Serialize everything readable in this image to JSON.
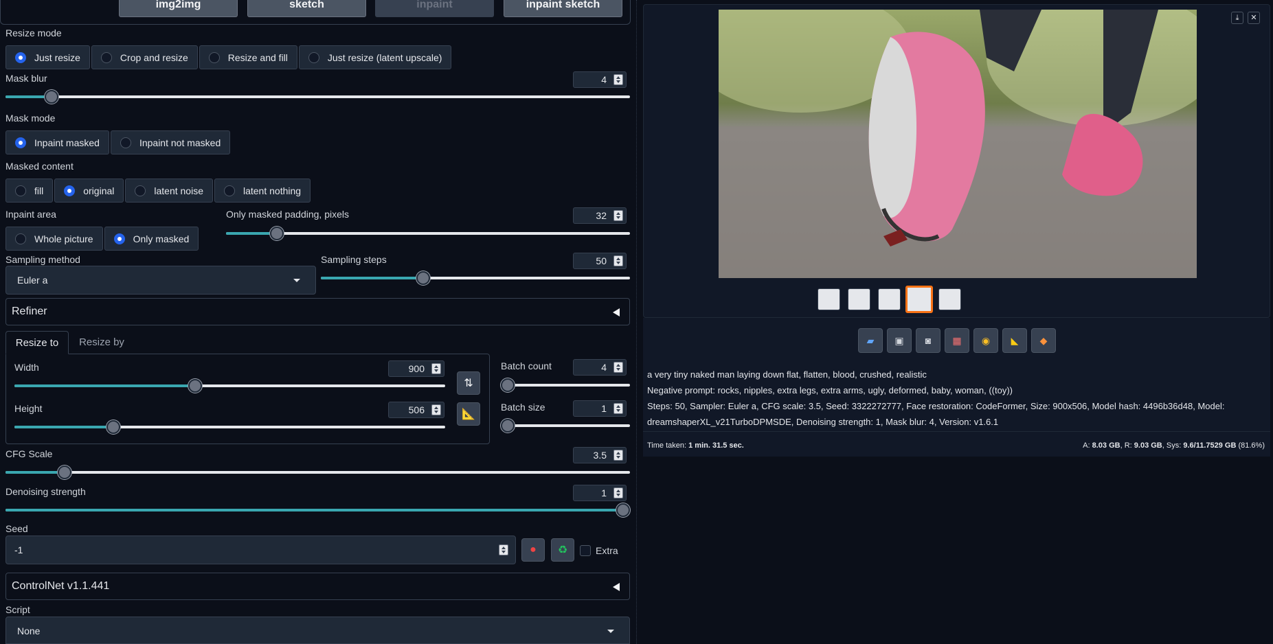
{
  "top_tabs": [
    {
      "label": "img2img",
      "disabled": false
    },
    {
      "label": "sketch",
      "disabled": false
    },
    {
      "label": "inpaint",
      "disabled": true
    },
    {
      "label": "inpaint sketch",
      "disabled": false
    }
  ],
  "resize_mode": {
    "label": "Resize mode",
    "options": [
      "Just resize",
      "Crop and resize",
      "Resize and fill",
      "Just resize (latent upscale)"
    ],
    "selected": "Just resize"
  },
  "mask_blur": {
    "label": "Mask blur",
    "value": "4",
    "fraction": 0.074
  },
  "mask_mode": {
    "label": "Mask mode",
    "options": [
      "Inpaint masked",
      "Inpaint not masked"
    ],
    "selected": "Inpaint masked"
  },
  "masked_content": {
    "label": "Masked content",
    "options": [
      "fill",
      "original",
      "latent noise",
      "latent nothing"
    ],
    "selected": "original"
  },
  "inpaint_area": {
    "label": "Inpaint area",
    "options": [
      "Whole picture",
      "Only masked"
    ],
    "selected": "Only masked"
  },
  "padding": {
    "label": "Only masked padding, pixels",
    "value": "32",
    "fraction": 0.125
  },
  "sampling_method": {
    "label": "Sampling method",
    "value": "Euler a"
  },
  "sampling_steps": {
    "label": "Sampling steps",
    "value": "50",
    "fraction": 0.33
  },
  "refiner": {
    "label": "Refiner"
  },
  "size_tabs": [
    {
      "label": "Resize to",
      "active": true
    },
    {
      "label": "Resize by",
      "active": false
    }
  ],
  "width": {
    "label": "Width",
    "value": "900",
    "fraction": 0.42
  },
  "height": {
    "label": "Height",
    "value": "506",
    "fraction": 0.23
  },
  "batch_count": {
    "label": "Batch count",
    "value": "4",
    "fraction": 0.0
  },
  "batch_size": {
    "label": "Batch size",
    "value": "1",
    "fraction": 0.0
  },
  "cfg_scale": {
    "label": "CFG Scale",
    "value": "3.5",
    "fraction": 0.095
  },
  "denoising": {
    "label": "Denoising strength",
    "value": "1",
    "fraction": 1.0
  },
  "seed": {
    "label": "Seed",
    "value": "-1",
    "extra_label": "Extra"
  },
  "controlnet": {
    "label": "ControlNet v1.1.441"
  },
  "script": {
    "label": "Script",
    "value": "None"
  },
  "output": {
    "prompt": "a very tiny naked man laying down flat, flatten, blood, crushed, realistic",
    "negative": "Negative prompt: rocks, nipples, extra legs, extra arms, ugly, deformed, baby, woman, ((toy))",
    "params_line1": "Steps: 50, Sampler: Euler a, CFG scale: 3.5, Seed: 3322272777, Face restoration: CodeFormer, Size: 900x506, Model hash: 4496b36d48, Model:",
    "params_line2": "dreamshaperXL_v21TurboDPMSDE, Denoising strength: 1, Mask blur: 4, Version: v1.6.1",
    "time_label": "Time taken:",
    "time_value": "1 min. 31.5 sec.",
    "mem_a_label": "A:",
    "mem_a": "8.03 GB",
    "mem_r_label": "R:",
    "mem_r": "9.03 GB",
    "mem_sys_label": "Sys:",
    "mem_sys": "9.6/11.7529 GB",
    "mem_pct": "(81.6%)"
  },
  "colors": {
    "accent": "#3aa7b0",
    "selected_thumb": "#f97316",
    "radio": "#2563eb"
  }
}
